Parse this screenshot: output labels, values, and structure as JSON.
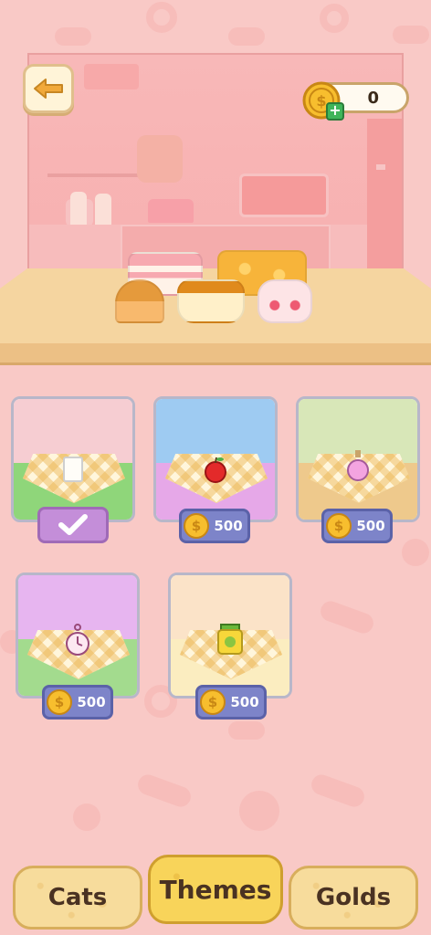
{
  "header": {
    "coin_count": "0",
    "back_icon": "back-arrow-icon",
    "coin_icon": "coin-icon",
    "add_icon": "plus-icon"
  },
  "themes": [
    {
      "name": "white-kitchen-milk",
      "item_icon": "milk-glass-icon",
      "state": "owned",
      "status_icon": "check-icon"
    },
    {
      "name": "blue-sky-apple",
      "item_icon": "apple-icon",
      "state": "locked",
      "price": "500"
    },
    {
      "name": "green-potion",
      "item_icon": "potion-bottle-icon",
      "state": "locked",
      "price": "500"
    },
    {
      "name": "purple-clock",
      "item_icon": "pocket-watch-icon",
      "state": "locked",
      "price": "500"
    },
    {
      "name": "cream-jar",
      "item_icon": "jam-jar-icon",
      "state": "locked",
      "price": "500"
    }
  ],
  "tabs": [
    {
      "label": "Cats",
      "active": false
    },
    {
      "label": "Themes",
      "active": true
    },
    {
      "label": "Golds",
      "active": false
    }
  ],
  "colors": {
    "background": "#f9c9c6",
    "price_button": "#7d84c9",
    "owned_button": "#c48ed9",
    "tab_active": "#f8d45a",
    "tab_inactive": "#f7dc9c"
  }
}
